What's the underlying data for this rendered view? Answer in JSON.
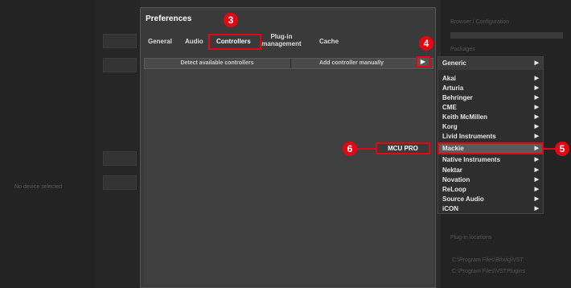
{
  "background": {
    "left_note": "No device selected",
    "right_header": "Browser / Configuration",
    "right_section": "Packages",
    "right_footer": "Plug-in locations",
    "right_paths": [
      "C:\\Program Files\\Bitwig\\VST",
      "C:\\Program Files\\VSTPlugins"
    ]
  },
  "dialog": {
    "title": "Preferences",
    "tabs": [
      {
        "label": "General"
      },
      {
        "label": "Audio"
      },
      {
        "label": "Controllers"
      },
      {
        "label": "Plug-in management"
      },
      {
        "label": "Cache"
      }
    ],
    "detect_button": "Detect available controllers",
    "add_button": "Add controller manually",
    "arrow_glyph": "▶"
  },
  "menu": {
    "items": [
      {
        "label": "Generic"
      },
      {
        "label": "Akai"
      },
      {
        "label": "Arturia"
      },
      {
        "label": "Behringer"
      },
      {
        "label": "CME"
      },
      {
        "label": "Keith McMillen"
      },
      {
        "label": "Korg"
      },
      {
        "label": "Livid Instruments"
      },
      {
        "label": "Mackie"
      },
      {
        "label": "Native Instruments"
      },
      {
        "label": "Nektar"
      },
      {
        "label": "Novation"
      },
      {
        "label": "ReLoop"
      },
      {
        "label": "Source Audio"
      },
      {
        "label": "iCON"
      }
    ],
    "chevron": "▶",
    "selected": "Mackie",
    "submenu_item": "MCU PRO"
  },
  "callouts": {
    "c3": "3",
    "c4": "4",
    "c5": "5",
    "c6": "6"
  },
  "colors": {
    "accent": "#e30613",
    "dialog_bg": "#3a3a3a",
    "menu_bg": "#2e2e2e"
  }
}
